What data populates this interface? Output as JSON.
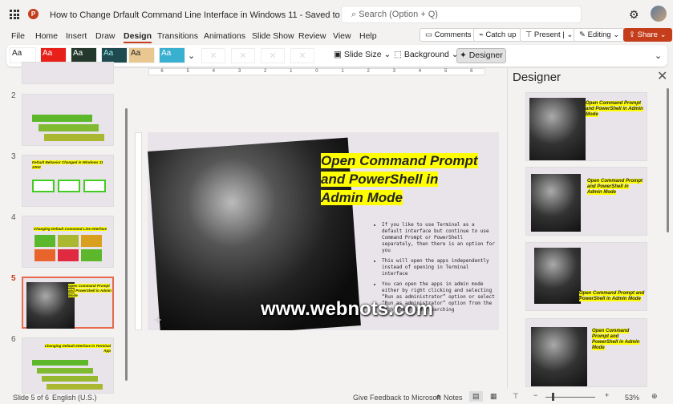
{
  "titlebar": {
    "doc_title": "How to Change Drfault Command Line Interface in Windows 11  -  Saved to OneDrive ⌄",
    "search_placeholder": "Search (Option + Q)",
    "app_icon": "P"
  },
  "menu": {
    "tabs": [
      "File",
      "Home",
      "Insert",
      "Draw",
      "Design",
      "Transitions",
      "Animations",
      "Slide Show",
      "Review",
      "View",
      "Help"
    ],
    "active": "Design"
  },
  "actions": {
    "comments": "Comments",
    "catch_up": "Catch up",
    "present": "Present",
    "editing": "Editing",
    "share": "Share"
  },
  "ribbon": {
    "themes": [
      "Aa",
      "Aa",
      "Aa",
      "Aa",
      "Aa",
      "Aa"
    ],
    "slide_size": "Slide Size",
    "background": "Background",
    "designer": "Designer"
  },
  "ruler": {
    "ticks": [
      "6",
      "5",
      "4",
      "3",
      "2",
      "1",
      "0",
      "1",
      "2",
      "3",
      "4",
      "5",
      "6"
    ]
  },
  "slides": [
    {
      "num": "2"
    },
    {
      "num": "3",
      "title": "Default Behavior Changed in Windows 11 22H2"
    },
    {
      "num": "4",
      "title": "Changing Default Command Line Interface"
    },
    {
      "num": "5",
      "title": "Open Command Prompt and PowerShell in Admin Mode"
    },
    {
      "num": "6",
      "title": "Changing Default Interface in Terminal App"
    }
  ],
  "current_slide": {
    "title_lines": [
      "Open Command Prompt",
      "and PowerShell in",
      "Admin Mode"
    ],
    "bullets": [
      "If you like to use Terminal as a default interface but continue to use Command Prompt or PowerShell separately, then there is an option for you",
      "This will open the apps independently instead of opening in Terminal interface",
      "You can open the apps in admin mode either by right clicking and selecting “Run as administrator” option or select “Run as administrator” option from the right pane when searching"
    ],
    "watermark": "www.webnots.com"
  },
  "designer": {
    "title": "Designer",
    "suggestion_title": "Open Command Prompt and PowerShell in Admin Mode"
  },
  "status": {
    "slide": "Slide 5 of 6",
    "language": "English (U.S.)",
    "feedback": "Give Feedback to Microsoft",
    "notes": "Notes",
    "zoom": "53%"
  }
}
